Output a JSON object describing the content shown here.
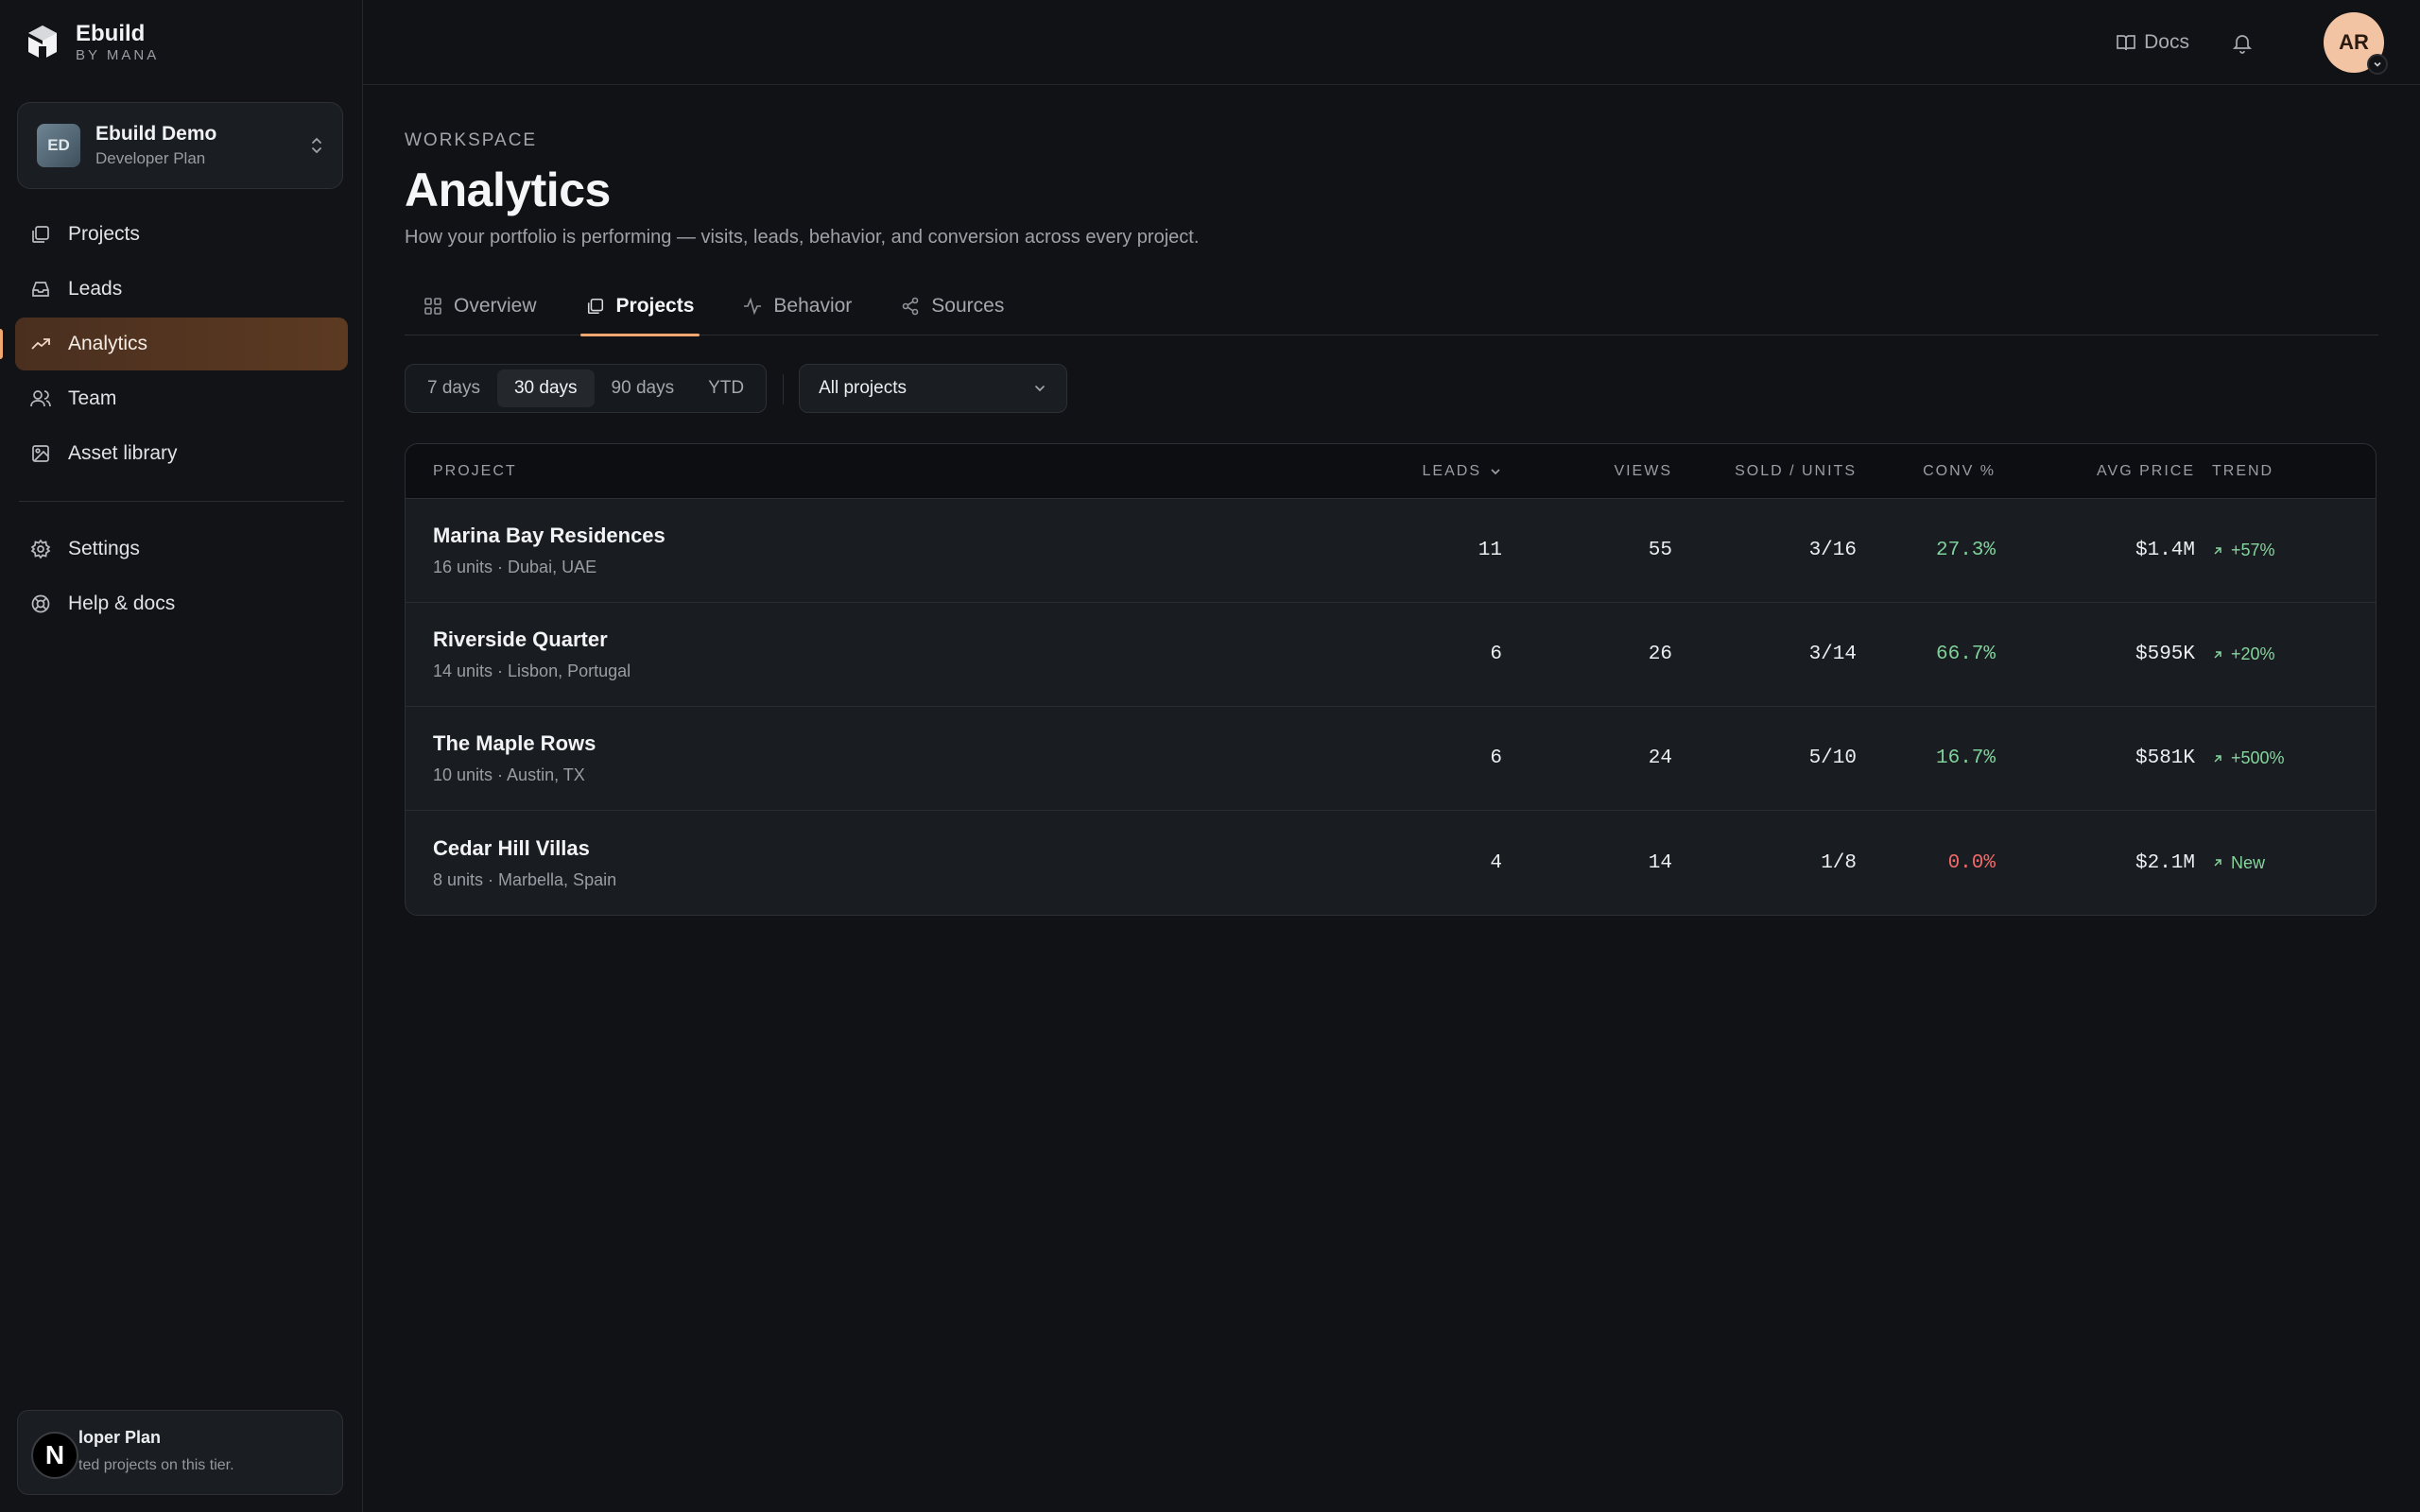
{
  "brand": {
    "name": "Ebuild",
    "sub": "BY MANA"
  },
  "workspace": {
    "initials": "ED",
    "name": "Ebuild Demo",
    "plan": "Developer Plan"
  },
  "nav": {
    "items": [
      {
        "label": "Projects",
        "icon": "projects-icon"
      },
      {
        "label": "Leads",
        "icon": "inbox-icon"
      },
      {
        "label": "Analytics",
        "icon": "trending-up-icon"
      },
      {
        "label": "Team",
        "icon": "users-icon"
      },
      {
        "label": "Asset library",
        "icon": "image-icon"
      }
    ],
    "secondary": [
      {
        "label": "Settings",
        "icon": "gear-icon"
      },
      {
        "label": "Help & docs",
        "icon": "lifebuoy-icon"
      }
    ],
    "active_index": 2
  },
  "plan_card": {
    "badge": "N",
    "title": "loper Plan",
    "desc": "ted projects on this tier."
  },
  "topbar": {
    "docs_label": "Docs",
    "avatar_initials": "AR"
  },
  "page": {
    "eyebrow": "WORKSPACE",
    "title": "Analytics",
    "description": "How your portfolio is performing — visits, leads, behavior, and conversion across every project."
  },
  "tabs": [
    {
      "label": "Overview",
      "icon": "grid-icon"
    },
    {
      "label": "Projects",
      "icon": "projects-icon"
    },
    {
      "label": "Behavior",
      "icon": "activity-icon"
    },
    {
      "label": "Sources",
      "icon": "share-icon"
    }
  ],
  "active_tab": 1,
  "filters": {
    "ranges": [
      "7 days",
      "30 days",
      "90 days",
      "YTD"
    ],
    "active_range": 1,
    "project_select": "All projects"
  },
  "table": {
    "headers": {
      "project": "PROJECT",
      "leads": "LEADS",
      "views": "VIEWS",
      "sold": "SOLD / UNITS",
      "conv": "CONV %",
      "price": "AVG PRICE",
      "trend": "TREND"
    },
    "rows": [
      {
        "name": "Marina Bay Residences",
        "meta": "16 units · Dubai, UAE",
        "leads": "11",
        "views": "55",
        "sold": "3/16",
        "conv": "27.3%",
        "conv_status": "good",
        "price": "$1.4M",
        "trend": "+57%"
      },
      {
        "name": "Riverside Quarter",
        "meta": "14 units · Lisbon, Portugal",
        "leads": "6",
        "views": "26",
        "sold": "3/14",
        "conv": "66.7%",
        "conv_status": "good",
        "price": "$595K",
        "trend": "+20%"
      },
      {
        "name": "The Maple Rows",
        "meta": "10 units · Austin, TX",
        "leads": "6",
        "views": "24",
        "sold": "5/10",
        "conv": "16.7%",
        "conv_status": "good",
        "price": "$581K",
        "trend": "+500%"
      },
      {
        "name": "Cedar Hill Villas",
        "meta": "8 units · Marbella, Spain",
        "leads": "4",
        "views": "14",
        "sold": "1/8",
        "conv": "0.0%",
        "conv_status": "bad",
        "price": "$2.1M",
        "trend": "New"
      }
    ]
  },
  "colors": {
    "accent": "#f0a870",
    "positive": "#7fd19a",
    "negative": "#f06a6a"
  }
}
